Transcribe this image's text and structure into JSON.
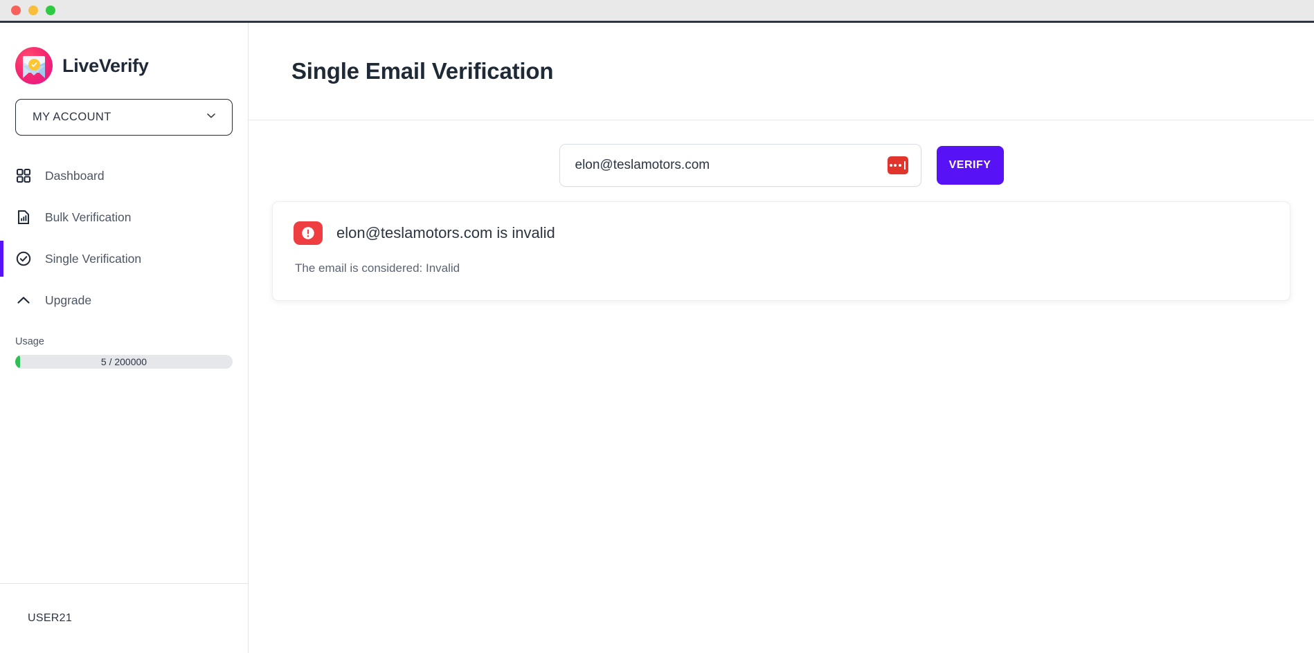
{
  "window": {
    "traffic_lights": [
      "close",
      "minimize",
      "maximize"
    ]
  },
  "sidebar": {
    "brand": {
      "name": "LiveVerify",
      "logo_icon": "envelope-check-logo"
    },
    "account_select": {
      "label": "MY ACCOUNT",
      "chevron_icon": "chevron-down-icon"
    },
    "nav_items": [
      {
        "label": "Dashboard",
        "icon": "grid-icon",
        "active": false
      },
      {
        "label": "Bulk Verification",
        "icon": "file-chart-icon",
        "active": false
      },
      {
        "label": "Single Verification",
        "icon": "check-circle-icon",
        "active": true
      },
      {
        "label": "Upgrade",
        "icon": "chevron-up-icon",
        "active": false
      }
    ],
    "usage": {
      "label": "Usage",
      "text": "5 / 200000",
      "used": 5,
      "total": 200000,
      "percent": 2.2,
      "fill_color": "#2ec057",
      "track_color": "#e5e7eb"
    },
    "footer": {
      "user": "USER21"
    },
    "active_indicator_color": "#5712f5"
  },
  "main": {
    "page_title": "Single Email Verification",
    "verify_form": {
      "email_value": "elon@teslamotors.com",
      "email_placeholder": "Enter email address",
      "password_manager_icon": "password-manager-icon",
      "verify_button_label": "VERIFY",
      "verify_button_color": "#5712f5"
    },
    "result": {
      "status_icon": "exclamation-circle-icon",
      "status_color": "#ef3e42",
      "headline": "elon@teslamotors.com is invalid",
      "detail": "The email is considered: Invalid"
    }
  }
}
